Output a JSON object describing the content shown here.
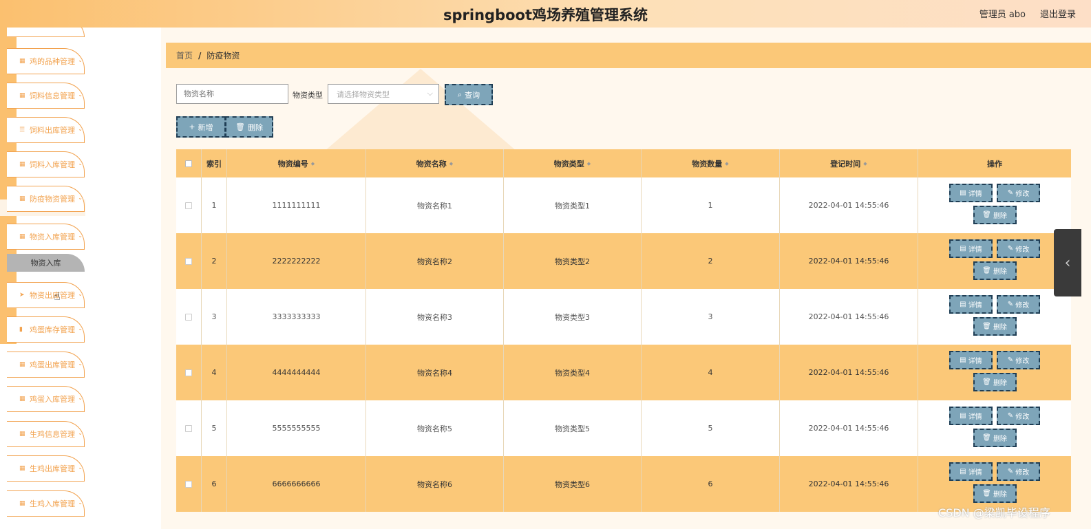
{
  "header": {
    "title": "springboot鸡场养殖管理系统",
    "user": "管理员 abo",
    "logout": "退出登录"
  },
  "sidebar": {
    "items": [
      {
        "label": "鸡的品种管理",
        "icon": "grid-icon"
      },
      {
        "label": "饲料信息管理",
        "icon": "grid-icon"
      },
      {
        "label": "饲料出库管理",
        "icon": "list-icon"
      },
      {
        "label": "饲料入库管理",
        "icon": "grid-icon"
      },
      {
        "label": "防疫物资管理",
        "icon": "grid-icon"
      },
      {
        "label": "物资入库管理",
        "icon": "grid-icon"
      },
      {
        "label": "物资出库管理",
        "icon": "send-icon"
      },
      {
        "label": "鸡蛋库存管理",
        "icon": "chart-icon"
      },
      {
        "label": "鸡蛋出库管理",
        "icon": "grid-icon"
      },
      {
        "label": "鸡蛋入库管理",
        "icon": "grid-icon"
      },
      {
        "label": "生鸡信息管理",
        "icon": "grid-icon"
      },
      {
        "label": "生鸡出库管理",
        "icon": "grid-icon"
      },
      {
        "label": "生鸡入库管理",
        "icon": "grid-icon"
      }
    ],
    "subitem": "物资入库"
  },
  "breadcrumb": {
    "home": "首页",
    "sep": "/",
    "current": "防疫物资"
  },
  "filters": {
    "name_placeholder": "物资名称",
    "type_label": "物资类型",
    "type_placeholder": "请选择物资类型",
    "query": "查询",
    "add": "新增",
    "delete": "删除"
  },
  "table": {
    "headers": [
      "索引",
      "物资编号",
      "物资名称",
      "物资类型",
      "物资数量",
      "登记时间",
      "操作"
    ],
    "rows": [
      {
        "idx": "1",
        "code": "1111111111",
        "name": "物资名称1",
        "type": "物资类型1",
        "qty": "1",
        "time": "2022-04-01 14:55:46"
      },
      {
        "idx": "2",
        "code": "2222222222",
        "name": "物资名称2",
        "type": "物资类型2",
        "qty": "2",
        "time": "2022-04-01 14:55:46"
      },
      {
        "idx": "3",
        "code": "3333333333",
        "name": "物资名称3",
        "type": "物资类型3",
        "qty": "3",
        "time": "2022-04-01 14:55:46"
      },
      {
        "idx": "4",
        "code": "4444444444",
        "name": "物资名称4",
        "type": "物资类型4",
        "qty": "4",
        "time": "2022-04-01 14:55:46"
      },
      {
        "idx": "5",
        "code": "5555555555",
        "name": "物资名称5",
        "type": "物资类型5",
        "qty": "5",
        "time": "2022-04-01 14:55:46"
      },
      {
        "idx": "6",
        "code": "6666666666",
        "name": "物资名称6",
        "type": "物资类型6",
        "qty": "6",
        "time": "2022-04-01 14:55:46"
      }
    ],
    "ops": {
      "detail": "详情",
      "edit": "修改",
      "delete": "删除"
    }
  },
  "watermark": "CSDN @梁凯毕设程序"
}
